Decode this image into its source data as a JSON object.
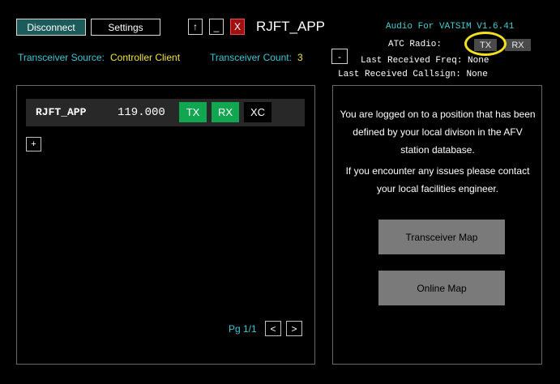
{
  "toolbar": {
    "disconnect_label": "Disconnect",
    "settings_label": "Settings",
    "up_label": "↑",
    "minimize_label": "_",
    "close_label": "X",
    "app_title": "RJFT_APP"
  },
  "version": "Audio For VATSIM V1.6.41",
  "transceiver": {
    "source_label": "Transceiver Source:",
    "source_value": "Controller Client",
    "count_label": "Transceiver Count:",
    "count_value": "3"
  },
  "atc_radio": {
    "label": "ATC Radio:",
    "tx_label": "TX",
    "rx_label": "RX"
  },
  "collapse_label": "-",
  "last_received": {
    "freq_label": "Last Received Freq:",
    "freq_value": "None",
    "callsign_label": "Last Received Callsign:",
    "callsign_value": "None"
  },
  "station": {
    "callsign": "RJFT_APP",
    "frequency": "119.000",
    "tx_label": "TX",
    "rx_label": "RX",
    "xc_label": "XC"
  },
  "add_label": "+",
  "pagination": {
    "label": "Pg 1/1",
    "prev": "<",
    "next": ">"
  },
  "info_panel": {
    "message_1": "You are logged on to a position that has been defined by your local divison in the AFV station database.",
    "message_2": "If you encounter any issues please contact your local facilities engineer.",
    "transceiver_map_label": "Transceiver Map",
    "online_map_label": "Online Map"
  },
  "colors": {
    "accent_teal": "#1c5b5a",
    "active_green": "#11a650",
    "label_cyan": "#3fc6d6",
    "value_yellow": "#f2e43a",
    "close_red": "#a01010",
    "highlight_yellow": "#f0e020"
  }
}
